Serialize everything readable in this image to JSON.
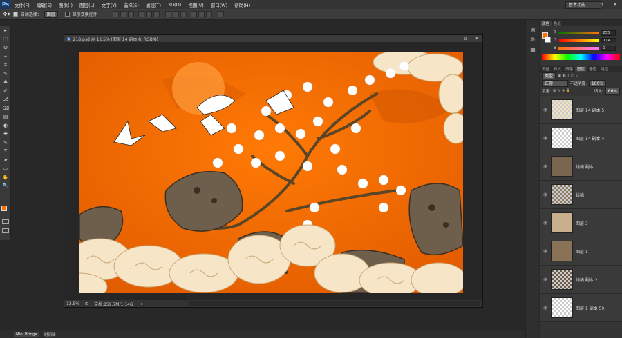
{
  "app": {
    "logo": "Ps"
  },
  "menu": [
    "文件(F)",
    "编辑(E)",
    "图像(I)",
    "图层(L)",
    "文字(Y)",
    "选择(S)",
    "滤镜(T)",
    "3D(D)",
    "视图(V)",
    "窗口(W)",
    "帮助(H)"
  ],
  "window_controls": [
    "–",
    "▫",
    "✕"
  ],
  "options": {
    "auto_select_label": "自动选择：",
    "auto_select_value": "图层",
    "show_transform_label": "显示变换控件"
  },
  "workspace": "基本功能",
  "tools": [
    "▸",
    "⬚",
    "ʘ",
    "⌖",
    "⌗",
    "✎",
    "✱",
    "✐",
    "⎇",
    "⌫",
    "▤",
    "◐",
    "✚",
    "✎",
    "T",
    "➤",
    "▭",
    "✋",
    "🔍"
  ],
  "document": {
    "title": "218.psd @ 12.5% (图层 14 副本 8, RGB/8)",
    "zoom": "12.5%",
    "doc_size": "文档:159.7M/1.14G"
  },
  "color_panel": {
    "tabs": [
      "颜色",
      "色板"
    ],
    "r_label": "R",
    "g_label": "G",
    "b_label": "B",
    "r": "255",
    "g": "114",
    "b": "0",
    "fg_color": "#ff7200"
  },
  "layers_panel": {
    "tabs": [
      "调整",
      "样式",
      "段落",
      "图层",
      "通道",
      "路径"
    ],
    "kind_label": "类型",
    "blend_mode": "正常",
    "opacity_label": "不透明度:",
    "opacity": "100%",
    "lock_label": "锁定:",
    "fill_label": "填充:",
    "fill": "66%",
    "layers": [
      {
        "name": "图层 14 副本 5"
      },
      {
        "name": "图层 14 副本 4"
      },
      {
        "name": "线稿 副本"
      },
      {
        "name": "线稿"
      },
      {
        "name": "图层 3"
      },
      {
        "name": "图层 1"
      },
      {
        "name": "线稿 副本 2"
      },
      {
        "name": "图层 1 副本 59"
      }
    ]
  },
  "bottom_tabs": [
    "Mini Bridge",
    "时间轴"
  ]
}
